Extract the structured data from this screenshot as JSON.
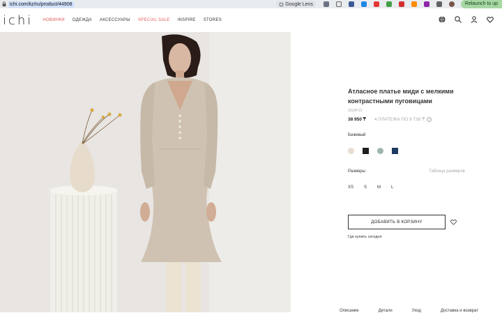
{
  "browser": {
    "url": "ichi.com/kz/ru/product/44908",
    "lens_label": "Google Lens",
    "relaunch_label": "Relaunch to up"
  },
  "header": {
    "logo": "ichi",
    "nav": [
      {
        "label": "НОВИНКИ",
        "accent": true
      },
      {
        "label": "ОДЕЖДА",
        "accent": false
      },
      {
        "label": "АКСЕССУАРЫ",
        "accent": false
      },
      {
        "label": "SPECIAL SALE",
        "accent": true
      },
      {
        "label": "INSPIRE",
        "accent": false
      },
      {
        "label": "STORES",
        "accent": false
      }
    ],
    "icons": [
      "globe-icon",
      "search-icon",
      "user-icon",
      "wishlist-icon"
    ]
  },
  "product": {
    "title": "Атласное платье миди с мелкими контрастными пуговицами",
    "article": "26UAT22",
    "price": "38 950 ₸",
    "installments": "4 ПЛАТЕЖА ПО 9 738 ₸",
    "color_name": "Бежевый",
    "colors": [
      "#e6dcd2",
      "#1f1f1f",
      "#9fb5b0",
      "#1e3a5f"
    ],
    "sizes_label": "Размеры",
    "size_chart_label": "Таблица размеров",
    "sizes": [
      "XS",
      "S",
      "M",
      "L"
    ],
    "add_to_cart": "ДОБАВИТЬ В КОРЗИНУ",
    "where_to_buy": "Где купить сегодня",
    "bottom_tabs": [
      "Описание",
      "Детали",
      "Уход",
      "Доставка и возврат"
    ]
  },
  "colors": {
    "accent_red": "#e15a5a",
    "photo_bg": "#e8e5e2"
  }
}
